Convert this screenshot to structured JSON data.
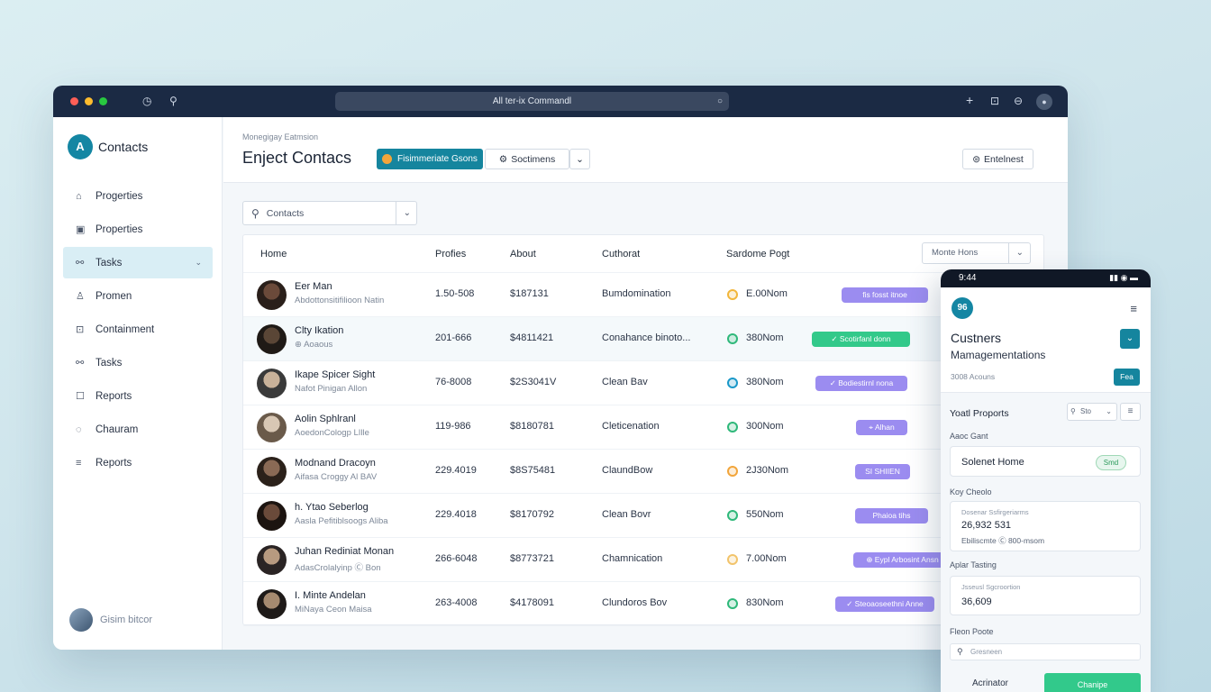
{
  "window": {
    "address": "All ter-ix Commandl",
    "dot_colors": [
      "#ff5f57",
      "#febc2e",
      "#28c840"
    ]
  },
  "sidebar": {
    "brand_logo": "A",
    "brand": "Contacts",
    "items": [
      {
        "label": "Progerties",
        "icon": "building-icon"
      },
      {
        "label": "Properties",
        "icon": "card-icon"
      },
      {
        "label": "Tasks",
        "icon": "tasks-icon",
        "active": true
      },
      {
        "label": "Promen",
        "icon": "person-icon"
      },
      {
        "label": "Containment",
        "icon": "box-icon"
      },
      {
        "label": "Tasks",
        "icon": "tasks-icon"
      },
      {
        "label": "Reports",
        "icon": "square-icon"
      },
      {
        "label": "Chauram",
        "icon": "chat-icon"
      },
      {
        "label": "Reports",
        "icon": "menu-icon"
      }
    ],
    "user_name": "Gisim bitcor"
  },
  "header": {
    "breadcrumb": "Monegigay Eatmsion",
    "title": "Enject Contacs",
    "primary_button": "Fisimmeriate Gsons",
    "secondary_button": "Soctimens",
    "right_button": "Entelnest"
  },
  "search": {
    "placeholder": "Contacts"
  },
  "table": {
    "headers": [
      "Home",
      "Profies",
      "About",
      "Cuthorat",
      "Sardome Pogt"
    ],
    "filter": "Monte Hons",
    "rows": [
      {
        "name": "Eer Man",
        "sub": "Abdottonsitifilioon Natin",
        "profiles": "1.50-508",
        "about": "$187131",
        "category": "Bumdomination",
        "owner": "E.00Nom",
        "owner_color": "#f2b63b",
        "tag": "fis fosst itnoe",
        "tag_color": "#9b8cf0"
      },
      {
        "name": "Clty Ikation",
        "sub": "⊕ Aoaous",
        "profiles": "201-666",
        "about": "$4811421",
        "category": "Conahance binoto...",
        "owner": "380Nom",
        "owner_color": "#2fb87a",
        "tag": "✓ Scotirfanl donn",
        "tag_color": "#33c98a",
        "highlight": true
      },
      {
        "name": "Ikape Spicer Sight",
        "sub": "Nafot Pinigan Allon",
        "profiles": "76-8008",
        "about": "$2S3041V",
        "category": "Clean Bav",
        "owner": "380Nom",
        "owner_color": "#1a98c9",
        "tag": "✓ Bodiestirnl nona",
        "tag_color": "#9b8cf0"
      },
      {
        "name": "Aolin Sphlranl",
        "sub": "AoedonCologp LIlle",
        "profiles": "119-986",
        "about": "$8180781",
        "category": "Cleticenation",
        "owner": "300Nom",
        "owner_color": "#2fb87a",
        "tag": "⌖ Alhan",
        "tag_color": "#9b8cf0"
      },
      {
        "name": "Modnand Dracoyn",
        "sub": "Aifasa Croggy Al BAV",
        "profiles": "229.4019",
        "about": "$8S75481",
        "category": "ClaundBow",
        "owner": "2J30Nom",
        "owner_color": "#f2a53b",
        "tag": "SI SHIIEN",
        "tag_color": "#9b8cf0"
      },
      {
        "name": "h. Ytao Seberlog",
        "sub": "Aasla Pefitiblsoogs Aliba",
        "profiles": "229.4018",
        "about": "$8170792",
        "category": "Clean Bovr",
        "owner": "550Nom",
        "owner_color": "#2fb87a",
        "tag": "Phaioa tihs",
        "tag_color": "#9b8cf0"
      },
      {
        "name": "Juhan Rediniat Monan",
        "sub": "AdasCrolalyinp Ⓒ Bon",
        "profiles": "266-6048",
        "about": "$8773721",
        "category": "Chamnication",
        "owner": "7.00Nom",
        "owner_color": "#f2c46b",
        "tag": "⊕ Eypl Arbosint Ansn",
        "tag_color": "#9b8cf0"
      },
      {
        "name": "I. Minte Andelan",
        "sub": "MiNaya Ceon Maisa",
        "profiles": "263-4008",
        "about": "$4178091",
        "category": "Clundoros Bov",
        "owner": "830Nom",
        "owner_color": "#2fb87a",
        "tag": "✓ Steoaoseethni Anne",
        "tag_color": "#9b8cf0"
      }
    ]
  },
  "phone": {
    "time": "9:44",
    "logo": "96",
    "title": "Custners",
    "subtitle": "Mamagementations",
    "small": "3008 Acouns",
    "small_button": "Fea",
    "section_title": "Yoatl Proports",
    "ctrl_placeholder": "Sto",
    "label1": "Aaoc Gant",
    "card1_text": "Solenet Home",
    "card1_badge": "Smd",
    "label2": "Koy Cheolo",
    "card2_top": "Dosenar Ssfirgeriarms",
    "card2_value": "26,932 531",
    "card2_note": "Ebiliscmte Ⓒ 800-msom",
    "label3": "Aplar Tasting",
    "card3_top": "Jsseusl Sgcroortion",
    "card3_value": "36,609",
    "label4": "Fleon Poote",
    "input_placeholder": "Gresneen",
    "footer_left": "Acrinator",
    "footer_button": "Chanipe"
  }
}
